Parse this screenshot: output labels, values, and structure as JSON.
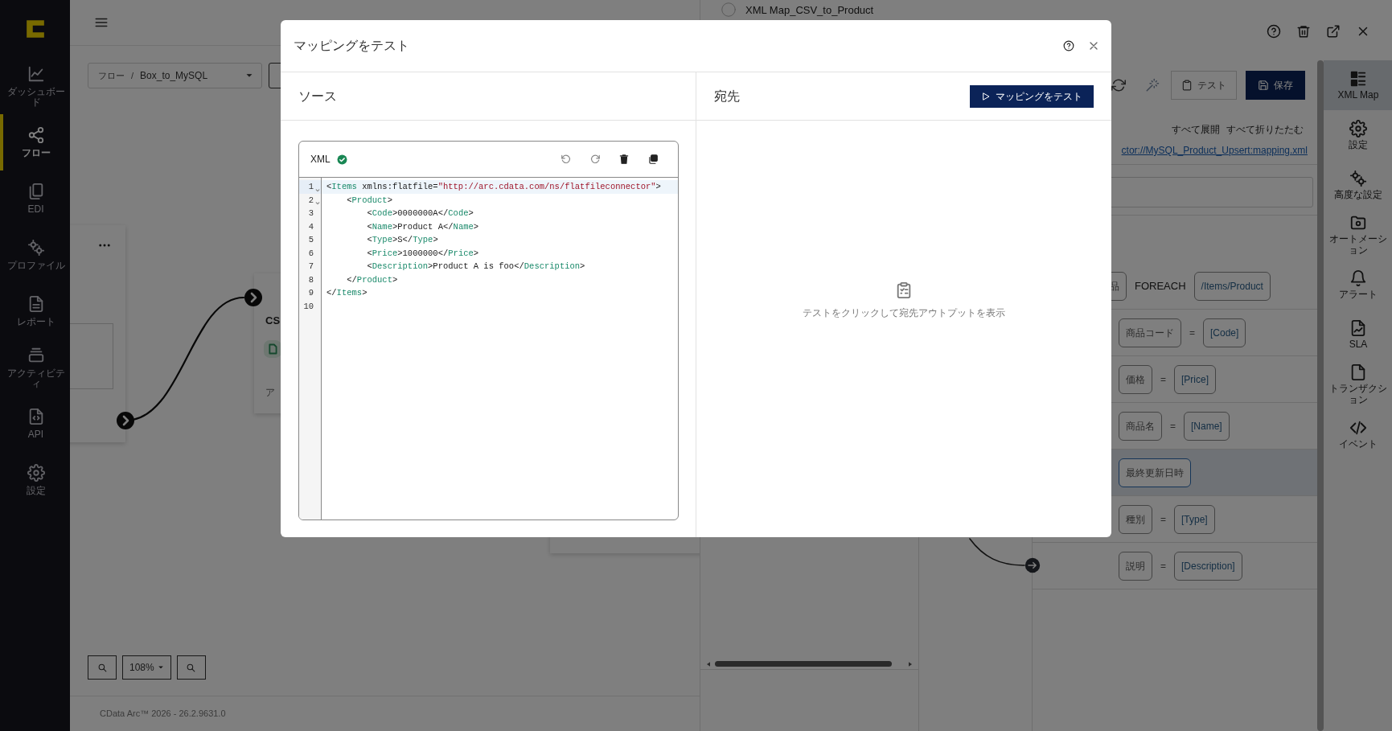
{
  "sidebar": {
    "items": [
      {
        "label": "ダッシュボード",
        "selected": false
      },
      {
        "label": "フロー",
        "selected": true
      },
      {
        "label": "EDI",
        "selected": false
      },
      {
        "label": "プロファイル",
        "selected": false
      },
      {
        "label": "レポート",
        "selected": false
      },
      {
        "label": "アクティビティ",
        "selected": false
      },
      {
        "label": "API",
        "selected": false
      },
      {
        "label": "設定",
        "selected": false
      }
    ]
  },
  "flow": {
    "breadcrumb": {
      "parent": "フロー",
      "separator": "/",
      "current": "Box_to_MySQL"
    },
    "nodes": [
      {
        "title": "CS",
        "subtitle": "ア"
      }
    ],
    "zoom": "108%",
    "footer": "CData Arc™ 2026 - 26.2.9631.0"
  },
  "panel": {
    "title": "XML Map_CSV_to_Product",
    "test_button": "テスト",
    "save_button": "保存",
    "tree_links": [
      "すべて展開",
      "すべて折りたたむ"
    ],
    "file_link": "ctor://MySQL_Product_Upsert:mapping.xml",
    "mappings": [
      {
        "kind": "loop",
        "target": "品",
        "operator": "FOREACH",
        "source": "/Items/Product",
        "selected": false
      },
      {
        "kind": "assign",
        "target": "商品コード",
        "operator": "=",
        "source": "[Code]",
        "selected": false
      },
      {
        "kind": "assign",
        "target": "価格",
        "operator": "=",
        "source": "[Price]",
        "selected": false
      },
      {
        "kind": "assign",
        "target": "商品名",
        "operator": "=",
        "source": "[Name]",
        "selected": false
      },
      {
        "kind": "empty",
        "target": "最終更新日時",
        "selected": true
      },
      {
        "kind": "assign",
        "target": "種別",
        "operator": "=",
        "source": "[Type]",
        "selected": false
      },
      {
        "kind": "assign",
        "target": "説明",
        "operator": "=",
        "source": "[Description]",
        "selected": false
      }
    ],
    "nav": [
      {
        "label": "XML Map",
        "selected": true
      },
      {
        "label": "設定",
        "selected": false
      },
      {
        "label": "高度な設定",
        "selected": false
      },
      {
        "label": "オートメーション",
        "selected": false
      },
      {
        "label": "アラート",
        "selected": false
      },
      {
        "label": "SLA",
        "selected": false
      },
      {
        "label": "トランザクション",
        "selected": false
      },
      {
        "label": "イベント",
        "selected": false
      }
    ]
  },
  "modal": {
    "title": "マッピングをテスト",
    "source": {
      "heading": "ソース",
      "editor": {
        "language": "XML",
        "valid": true,
        "lines": [
          {
            "number": "1",
            "text": "<Items xmlns:flatfile=\"http://arc.cdata.com/ns/flatfileconnector\">",
            "foldable": true,
            "active": true
          },
          {
            "number": "2",
            "text": "    <Product>",
            "foldable": true,
            "active": false
          },
          {
            "number": "3",
            "text": "        <Code>0000000A</Code>",
            "foldable": false,
            "active": false
          },
          {
            "number": "4",
            "text": "        <Name>Product A</Name>",
            "foldable": false,
            "active": false
          },
          {
            "number": "5",
            "text": "        <Type>S</Type>",
            "foldable": false,
            "active": false
          },
          {
            "number": "6",
            "text": "        <Price>1000000</Price>",
            "foldable": false,
            "active": false
          },
          {
            "number": "7",
            "text": "        <Description>Product A is foo</Description>",
            "foldable": false,
            "active": false
          },
          {
            "number": "8",
            "text": "    </Product>",
            "foldable": false,
            "active": false
          },
          {
            "number": "9",
            "text": "</Items>",
            "foldable": false,
            "active": false
          },
          {
            "number": "10",
            "foldable": false,
            "active": false
          }
        ]
      }
    },
    "destination": {
      "heading": "宛先",
      "button": "マッピングをテスト",
      "empty_text": "テストをクリックして宛先アウトプットを表示"
    }
  }
}
